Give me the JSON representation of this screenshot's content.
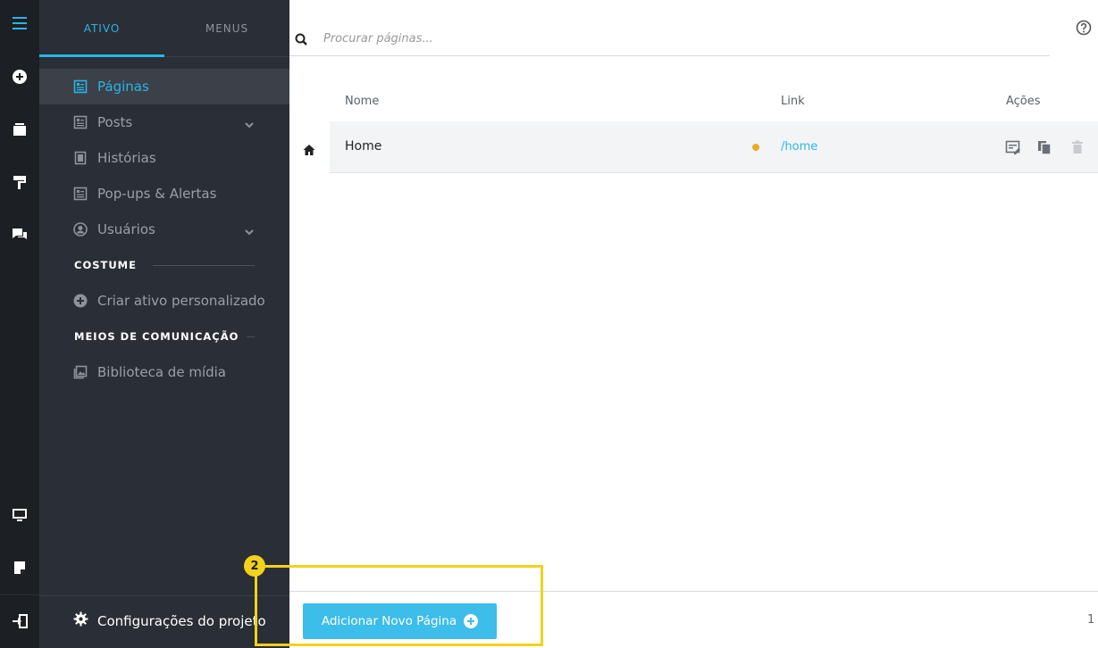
{
  "sidebar": {
    "tabs": [
      {
        "label": "ATIVO",
        "active": true
      },
      {
        "label": "MENUS",
        "active": false
      }
    ],
    "items": [
      {
        "label": "Páginas",
        "icon": "page-icon",
        "active": true
      },
      {
        "label": "Posts",
        "icon": "page-icon",
        "expandable": true
      },
      {
        "label": "Histórias",
        "icon": "page-icon"
      },
      {
        "label": "Pop-ups & Alertas",
        "icon": "page-icon"
      },
      {
        "label": "Usuários",
        "icon": "user-circle-icon",
        "expandable": true
      }
    ],
    "sections": {
      "costume": {
        "title": "COSTUME",
        "items": [
          {
            "label": "Criar ativo personalizado",
            "icon": "plus-circle-icon"
          }
        ]
      },
      "media": {
        "title": "MEIOS DE COMUNICAÇÃO",
        "items": [
          {
            "label": "Biblioteca de mídia",
            "icon": "image-icon"
          }
        ]
      }
    },
    "footer": {
      "label": "Configurações do projeto",
      "icon": "gear-icon"
    }
  },
  "rail": {
    "icons": [
      "menu-icon",
      "plus-circle-icon",
      "layers-icon",
      "paint-roller-icon",
      "chat-icon",
      "monitor-icon",
      "note-icon",
      "exit-icon"
    ]
  },
  "main": {
    "search": {
      "placeholder": "Procurar páginas..."
    },
    "table": {
      "headers": {
        "name": "Nome",
        "link": "Link",
        "actions": "Ações"
      },
      "rows": [
        {
          "name": "Home",
          "link": "/home",
          "status_color": "#e8ad26",
          "is_home": true
        }
      ]
    },
    "add_button": {
      "label": "Adicionar Novo Página"
    },
    "pagination": {
      "page": "1"
    }
  },
  "annotation": {
    "badge": "2"
  },
  "colors": {
    "accent": "#29b6e6",
    "button": "#3dbde9",
    "rail_bg": "#1c1f24",
    "panel_bg": "#2a2e36",
    "highlight": "#f2d21b",
    "status_dot": "#e8ad26"
  }
}
